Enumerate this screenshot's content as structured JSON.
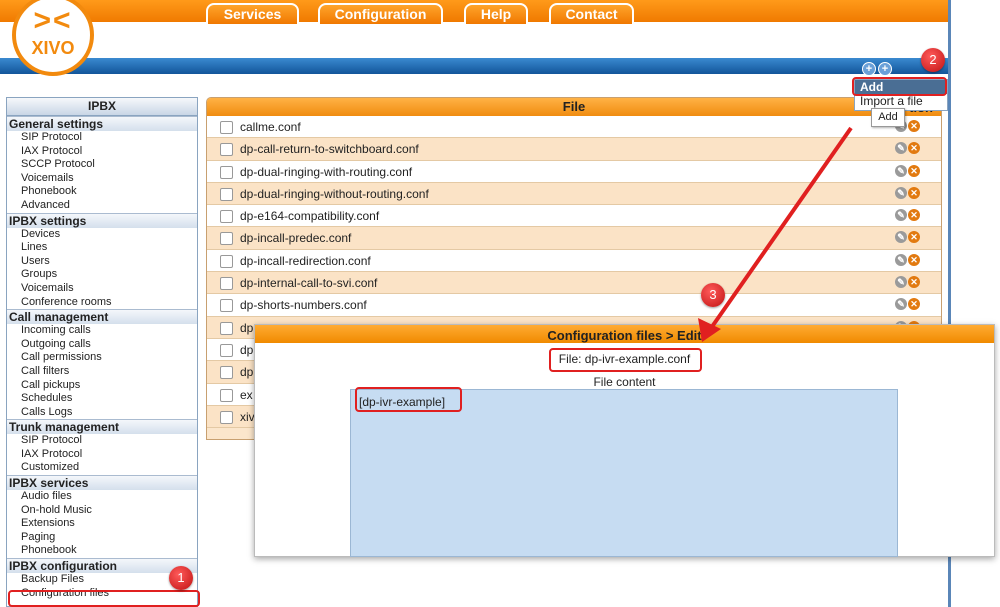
{
  "header": {
    "logo_text": "XIVO",
    "logo_mark": "><",
    "nav_tabs": [
      {
        "label": "Services"
      },
      {
        "label": "Configuration"
      },
      {
        "label": "Help"
      },
      {
        "label": "Contact"
      }
    ]
  },
  "sidebar": {
    "title": "IPBX",
    "sections": [
      {
        "title": "General settings",
        "items": [
          "SIP Protocol",
          "IAX Protocol",
          "SCCP Protocol",
          "Voicemails",
          "Phonebook",
          "Advanced"
        ]
      },
      {
        "title": "IPBX settings",
        "items": [
          "Devices",
          "Lines",
          "Users",
          "Groups",
          "Voicemails",
          "Conference rooms"
        ]
      },
      {
        "title": "Call management",
        "items": [
          "Incoming calls",
          "Outgoing calls",
          "Call permissions",
          "Call filters",
          "Call pickups",
          "Schedules",
          "Calls Logs"
        ]
      },
      {
        "title": "Trunk management",
        "items": [
          "SIP Protocol",
          "IAX Protocol",
          "Customized"
        ]
      },
      {
        "title": "IPBX services",
        "items": [
          "Audio files",
          "On-hold Music",
          "Extensions",
          "Paging",
          "Phonebook"
        ]
      },
      {
        "title": "IPBX configuration",
        "items": [
          "Backup Files",
          "Configuration files"
        ]
      }
    ]
  },
  "file_panel": {
    "header": "File",
    "action_header_visible": "tion",
    "files": [
      "callme.conf",
      "dp-call-return-to-switchboard.conf",
      "dp-dual-ringing-with-routing.conf",
      "dp-dual-ringing-without-routing.conf",
      "dp-e164-compatibility.conf",
      "dp-incall-predec.conf",
      "dp-incall-redirection.conf",
      "dp-internal-call-to-svi.conf",
      "dp-shorts-numbers.conf",
      "dp",
      "dp",
      "dp",
      "ex",
      "xiv"
    ]
  },
  "add_menu": {
    "items": [
      "Add",
      "Import a file"
    ],
    "tooltip": "Add"
  },
  "edit_popup": {
    "title": "Configuration files > Edit",
    "file_line": "File: dp-ivr-example.conf",
    "content_label": "File content",
    "content": "[dp-ivr-example]"
  },
  "annotations": {
    "badges": [
      "1",
      "2",
      "3"
    ],
    "color": "#e02020"
  },
  "colors": {
    "orange": "#f08a00",
    "blue": "#1c64a8"
  }
}
